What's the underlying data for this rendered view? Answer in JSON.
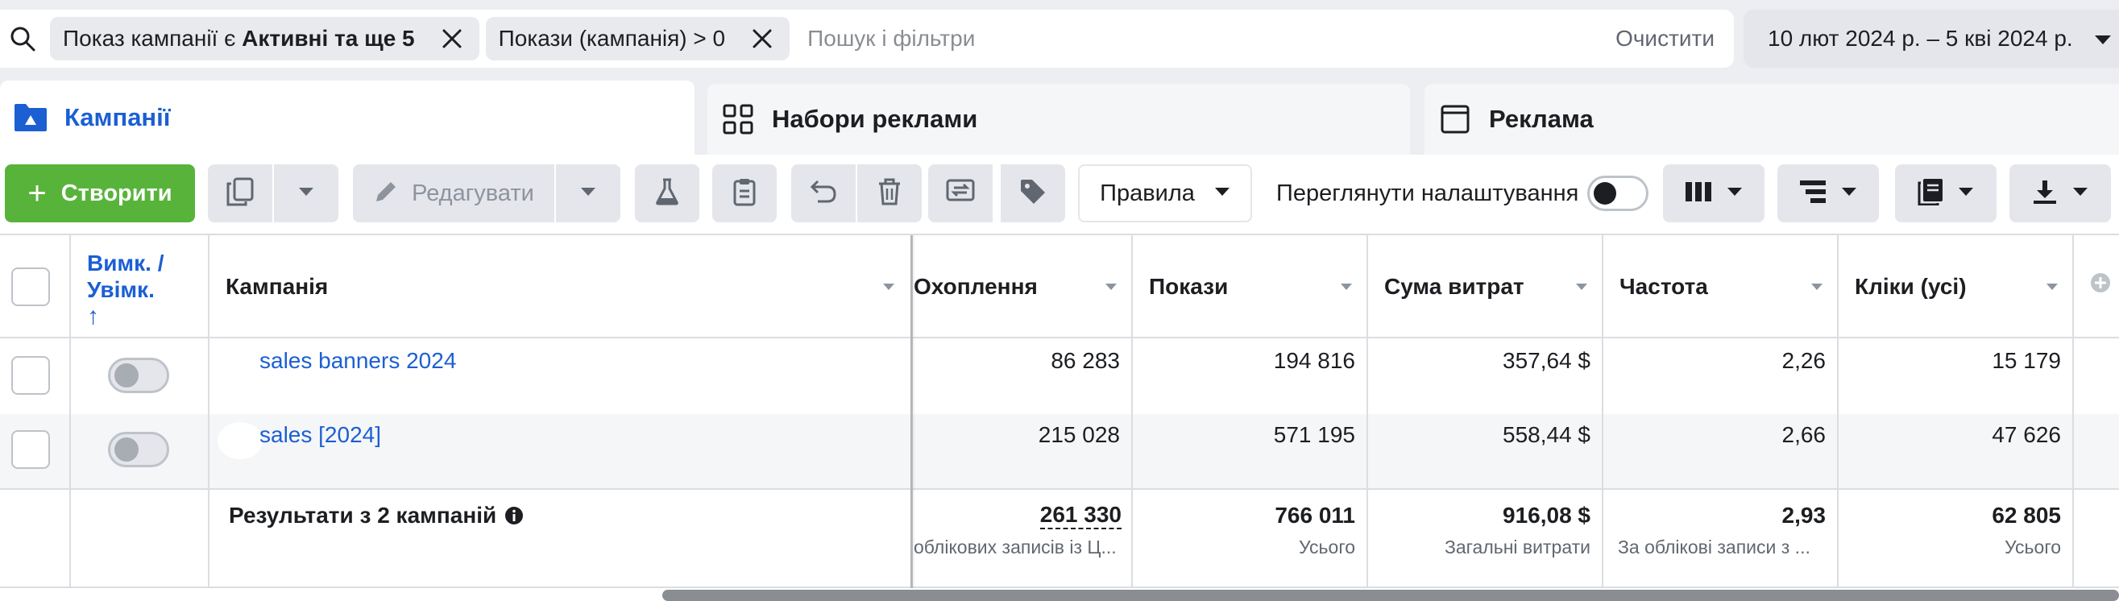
{
  "filters": {
    "chips": [
      {
        "prefix": "Показ кампанії є ",
        "bold": "Активні та ще 5"
      },
      {
        "prefix": "Покази (кампанія) > 0",
        "bold": ""
      }
    ],
    "placeholder": "Пошук і фільтри",
    "clear_label": "Очистити",
    "date_range": "10 лют 2024 р. – 5 кві 2024 р."
  },
  "tabs": [
    {
      "label": "Кампанії",
      "icon": "folder-icon"
    },
    {
      "label": "Набори реклами",
      "icon": "grid-icon"
    },
    {
      "label": "Реклама",
      "icon": "ad-frame-icon"
    }
  ],
  "toolbar": {
    "create_label": "Створити",
    "edit_label": "Редагувати",
    "rules_label": "Правила",
    "view_settings_label": "Переглянути налаштування"
  },
  "table": {
    "headers": {
      "toggle": "Вимк. / Увімк.",
      "toggle_sort": "↑",
      "campaign": "Кампанія",
      "reach": "Охоплення",
      "impressions": "Покази",
      "spend": "Сума витрат",
      "frequency": "Частота",
      "clicks": "Кліки (усі)"
    },
    "rows": [
      {
        "name": "sales banners 2024",
        "reach": "86 283",
        "impressions": "194 816",
        "spend": "357,64 $",
        "frequency": "2,26",
        "clicks": "15 179"
      },
      {
        "name": "sales [2024]",
        "reach": "215 028",
        "impressions": "571 195",
        "spend": "558,44 $",
        "frequency": "2,66",
        "clicks": "47 626"
      }
    ],
    "totals": {
      "label": "Результати з 2 кампаній",
      "reach": "261 330",
      "reach_sub": "облікових записів із Ц...",
      "impressions": "766 011",
      "impressions_sub": "Усього",
      "spend": "916,08 $",
      "spend_sub": "Загальні витрати",
      "frequency": "2,93",
      "frequency_sub": "За облікові записи з ...",
      "clicks": "62 805",
      "clicks_sub": "Усього"
    }
  },
  "colors": {
    "accent": "#1b5fd3",
    "create": "#58b33b"
  }
}
